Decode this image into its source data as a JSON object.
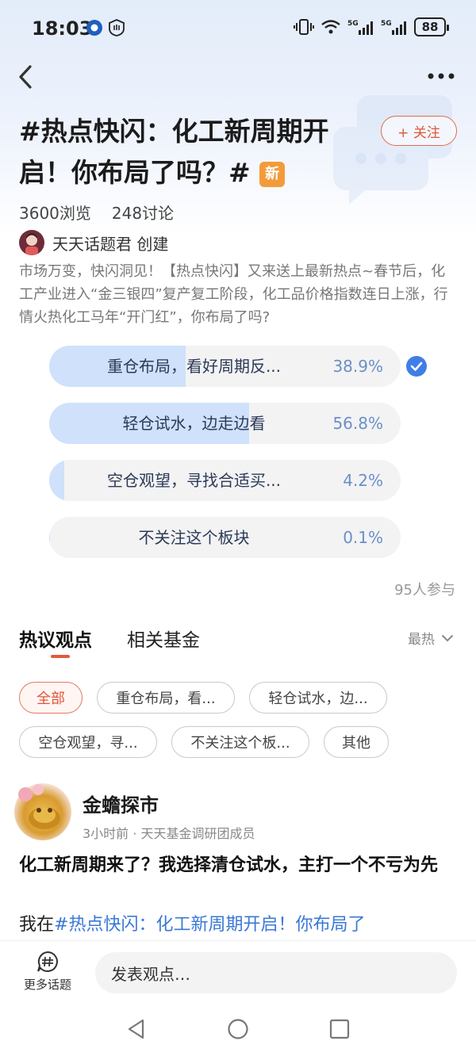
{
  "status_bar": {
    "time": "18:03",
    "battery": "88",
    "signal_1": "5G",
    "signal_2": "5G"
  },
  "header": {
    "title": "#热点快闪：化工新周期开启！你布局了吗？#",
    "new_badge": "新",
    "follow_label": "+ 关注"
  },
  "stats": {
    "views": "3600浏览",
    "discussions": "248讨论"
  },
  "creator": {
    "name": "天天话题君 创建"
  },
  "description": "市场万变，快闪洞见！【热点快闪】又来送上最新热点~春节后，化工产业进入“金三银四”复产复工阶段，化工品价格指数连日上涨，行情火热化工马年“开门红”，你布局了吗?",
  "poll": {
    "options": [
      {
        "label": "重仓布局，看好周期反...",
        "percent_text": "38.9%",
        "percent": 38.9,
        "selected": true
      },
      {
        "label": "轻仓试水，边走边看",
        "percent_text": "56.8%",
        "percent": 56.8,
        "selected": false
      },
      {
        "label": "空仓观望，寻找合适买...",
        "percent_text": "4.2%",
        "percent": 4.2,
        "selected": false
      },
      {
        "label": "不关注这个板块",
        "percent_text": "0.1%",
        "percent": 0.1,
        "selected": false
      }
    ],
    "participants": "95人参与",
    "accent_fill": "#cfe1fb",
    "check_color": "#3f7ee6"
  },
  "tabs": [
    {
      "label": "热议观点",
      "active": true
    },
    {
      "label": "相关基金",
      "active": false
    }
  ],
  "sort": {
    "label": "最热"
  },
  "chips": [
    {
      "label": "全部",
      "active": true
    },
    {
      "label": "重仓布局，看...",
      "active": false
    },
    {
      "label": "轻仓试水，边...",
      "active": false
    },
    {
      "label": "空仓观望，寻...",
      "active": false
    },
    {
      "label": "不关注这个板...",
      "active": false
    },
    {
      "label": "其他",
      "active": false
    }
  ],
  "post": {
    "author": "金蟾探市",
    "meta": "3小时前 · 天天基金调研团成员",
    "title": "化工新周期来了？我选择清仓试水，主打一个不亏为先",
    "body_prefix": "我在",
    "body_link": "#热点快闪：化工新周期开启！你布局了"
  },
  "bottom_bar": {
    "more_topics_label": "更多话题",
    "comment_placeholder": "发表观点…"
  }
}
